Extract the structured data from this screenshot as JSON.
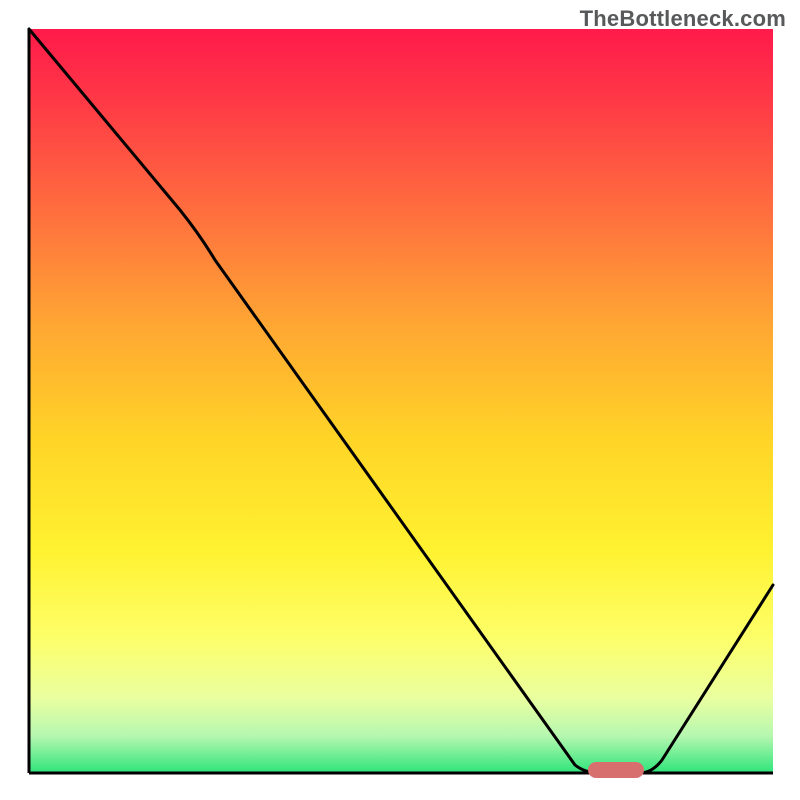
{
  "attribution": "TheBottleneck.com",
  "chart_data": {
    "type": "line",
    "title": "",
    "xlabel": "",
    "ylabel": "",
    "xlim": [
      0,
      100
    ],
    "ylim": [
      0,
      100
    ],
    "x": [
      0,
      22,
      74,
      82,
      100
    ],
    "values": [
      100,
      75,
      0,
      0,
      25
    ],
    "marker": {
      "x_start": 75,
      "x_end": 82,
      "y": 0,
      "color": "#d86f6f"
    },
    "background": "rainbow-vertical"
  }
}
